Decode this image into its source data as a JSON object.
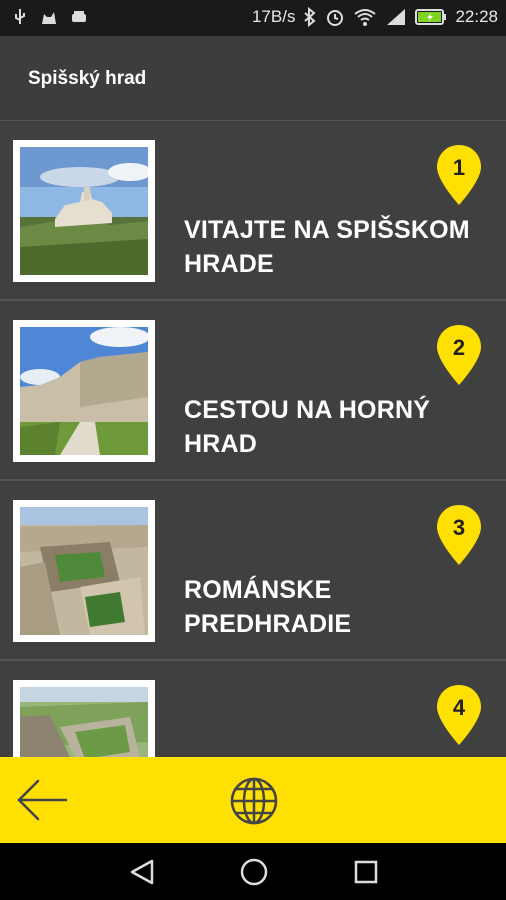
{
  "status": {
    "speed": "17B/s",
    "time": "22:28",
    "icons": [
      "usb-icon",
      "cat-icon",
      "car-icon",
      "bluetooth-icon",
      "alarm-icon",
      "wifi-icon",
      "signal-icon",
      "battery-icon"
    ]
  },
  "header": {
    "title": "Spišský hrad"
  },
  "items": [
    {
      "number": "1",
      "label": "VITAJTE NA SPIŠSKOM HRADE"
    },
    {
      "number": "2",
      "label": "CESTOU NA HORNÝ HRAD"
    },
    {
      "number": "3",
      "label": "ROMÁNSKE PREDHRADIE"
    },
    {
      "number": "4",
      "label": ""
    }
  ],
  "toolbar": {
    "back_icon": "back-arrow-icon",
    "language_icon": "globe-icon"
  },
  "navbar": {
    "icons": [
      "back-triangle-icon",
      "home-circle-icon",
      "recents-square-icon"
    ]
  },
  "colors": {
    "accent": "#ffe000",
    "list_bg": "#404040",
    "header_bg": "#3d3d3d",
    "status_bg": "#1a1a1a"
  }
}
